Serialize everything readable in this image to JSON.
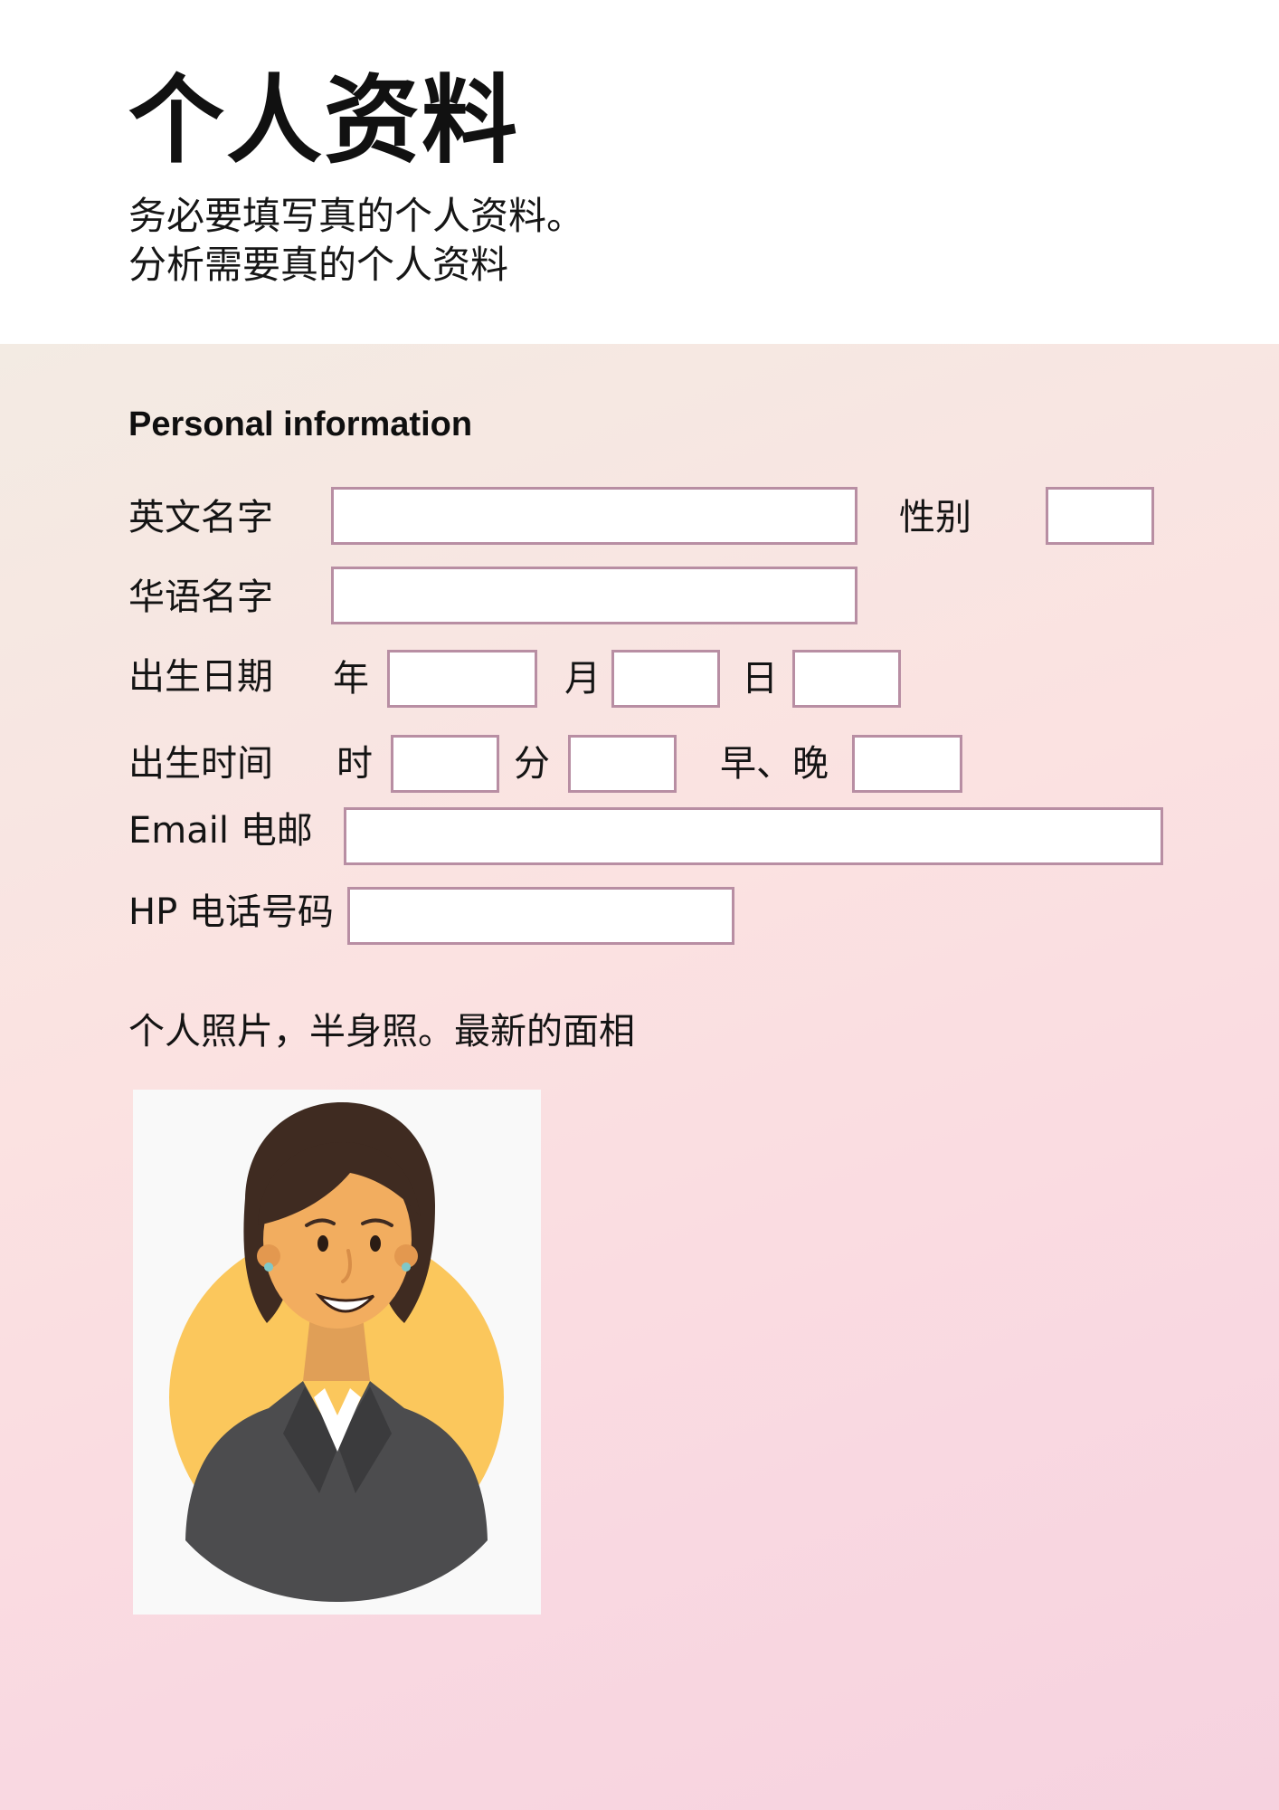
{
  "header": {
    "title": "个人资料",
    "subtitle_lines": [
      "务必要填写真的个人资料。",
      "分析需要真的个人资料"
    ]
  },
  "form": {
    "section_title": "Personal information",
    "labels": {
      "english_name": "英文名字",
      "gender": "性别",
      "chinese_name": "华语名字",
      "birth_date": "出生日期",
      "year": "年",
      "month": "月",
      "day": "日",
      "birth_time": "出生时间",
      "hour": "时",
      "minute": "分",
      "am_pm": "早、晚",
      "email": "Email 电邮",
      "phone": "HP 电话号码"
    },
    "values": {
      "english_name": "",
      "gender": "",
      "chinese_name": "",
      "year": "",
      "month": "",
      "day": "",
      "hour": "",
      "minute": "",
      "am_pm": "",
      "email": "",
      "phone": ""
    }
  },
  "photo": {
    "caption": "个人照片，半身照。最新的面相",
    "avatar_icon": "woman-avatar-icon"
  },
  "colors": {
    "field_border": "#b88ea3",
    "panel_gradient_start": "#f3ebe3",
    "panel_gradient_end": "#f6d2df",
    "avatar_circle": "#fbc75c"
  }
}
